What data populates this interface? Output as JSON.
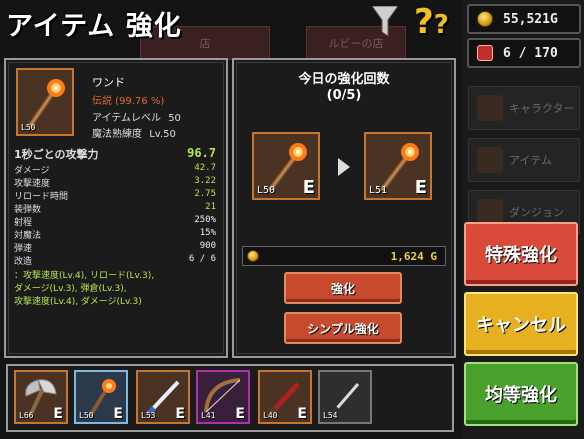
{
  "header": {
    "title": "アイテム 強化",
    "help_label": "?"
  },
  "currency": {
    "gold": "55,521G",
    "inventory": "6 / 170"
  },
  "background": {
    "top_buttons": [
      "店",
      "ルビーの店"
    ],
    "menu_items": [
      "キャラクター",
      "アイテム",
      "ダンジョン"
    ]
  },
  "item": {
    "name": "ワンド",
    "rarity_line": "伝説 (99.76 %)",
    "item_level_label": "アイテムレベル",
    "item_level_value": "50",
    "mastery_label": "魔法熟練度",
    "mastery_value": "Lv.50",
    "level_badge": "L50"
  },
  "stats": {
    "dps_label": "1秒ごとの攻撃力",
    "dps_value": "96.7",
    "rows": [
      {
        "label": "ダメージ",
        "value": "42.7"
      },
      {
        "label": "攻撃速度",
        "value": "3.22"
      },
      {
        "label": "リロード時間",
        "value": "2.75"
      },
      {
        "label": "装弾数",
        "value": "21"
      },
      {
        "label": "射程",
        "value": "250%"
      },
      {
        "label": "対魔法",
        "value": "15%"
      },
      {
        "label": "弾速",
        "value": "900"
      },
      {
        "label": "改造",
        "value": "6 / 6"
      }
    ],
    "mods": [
      "：攻撃速度(Lv.4), リロード(Lv.3),",
      "ダメージ(Lv.3), 弾倉(Lv.3),",
      "攻撃速度(Lv.4), ダメージ(Lv.3)"
    ]
  },
  "enhance": {
    "title": "今日の強化回数",
    "count": "(0/5)",
    "from_level": "L50",
    "to_level": "L51",
    "grade": "E",
    "cost": "1,624 G",
    "enhance_button": "強化",
    "simple_button": "シンプル強化"
  },
  "actions": {
    "special": "特殊強化",
    "cancel": "キャンセル",
    "equal": "均等強化"
  },
  "inventory_slots": [
    {
      "level": "L66",
      "grade": "E",
      "kind": "axe",
      "frame": "orange"
    },
    {
      "level": "L50",
      "grade": "E",
      "kind": "wand",
      "frame": "selected"
    },
    {
      "level": "L53",
      "grade": "E",
      "kind": "sword",
      "frame": "orange"
    },
    {
      "level": "L41",
      "grade": "E",
      "kind": "bow",
      "frame": "purple"
    },
    {
      "level": "L40",
      "grade": "E",
      "kind": "dagger",
      "frame": "orange"
    },
    {
      "level": "L54",
      "grade": "",
      "kind": "knife",
      "frame": "grey"
    }
  ],
  "colors": {
    "accent_green": "#b6e64a",
    "legend_orange": "#e06a2a",
    "frame_orange": "#c8762e",
    "red_button": "#d94a3a",
    "yellow_button": "#e6b020",
    "green_button": "#4aa02c"
  }
}
